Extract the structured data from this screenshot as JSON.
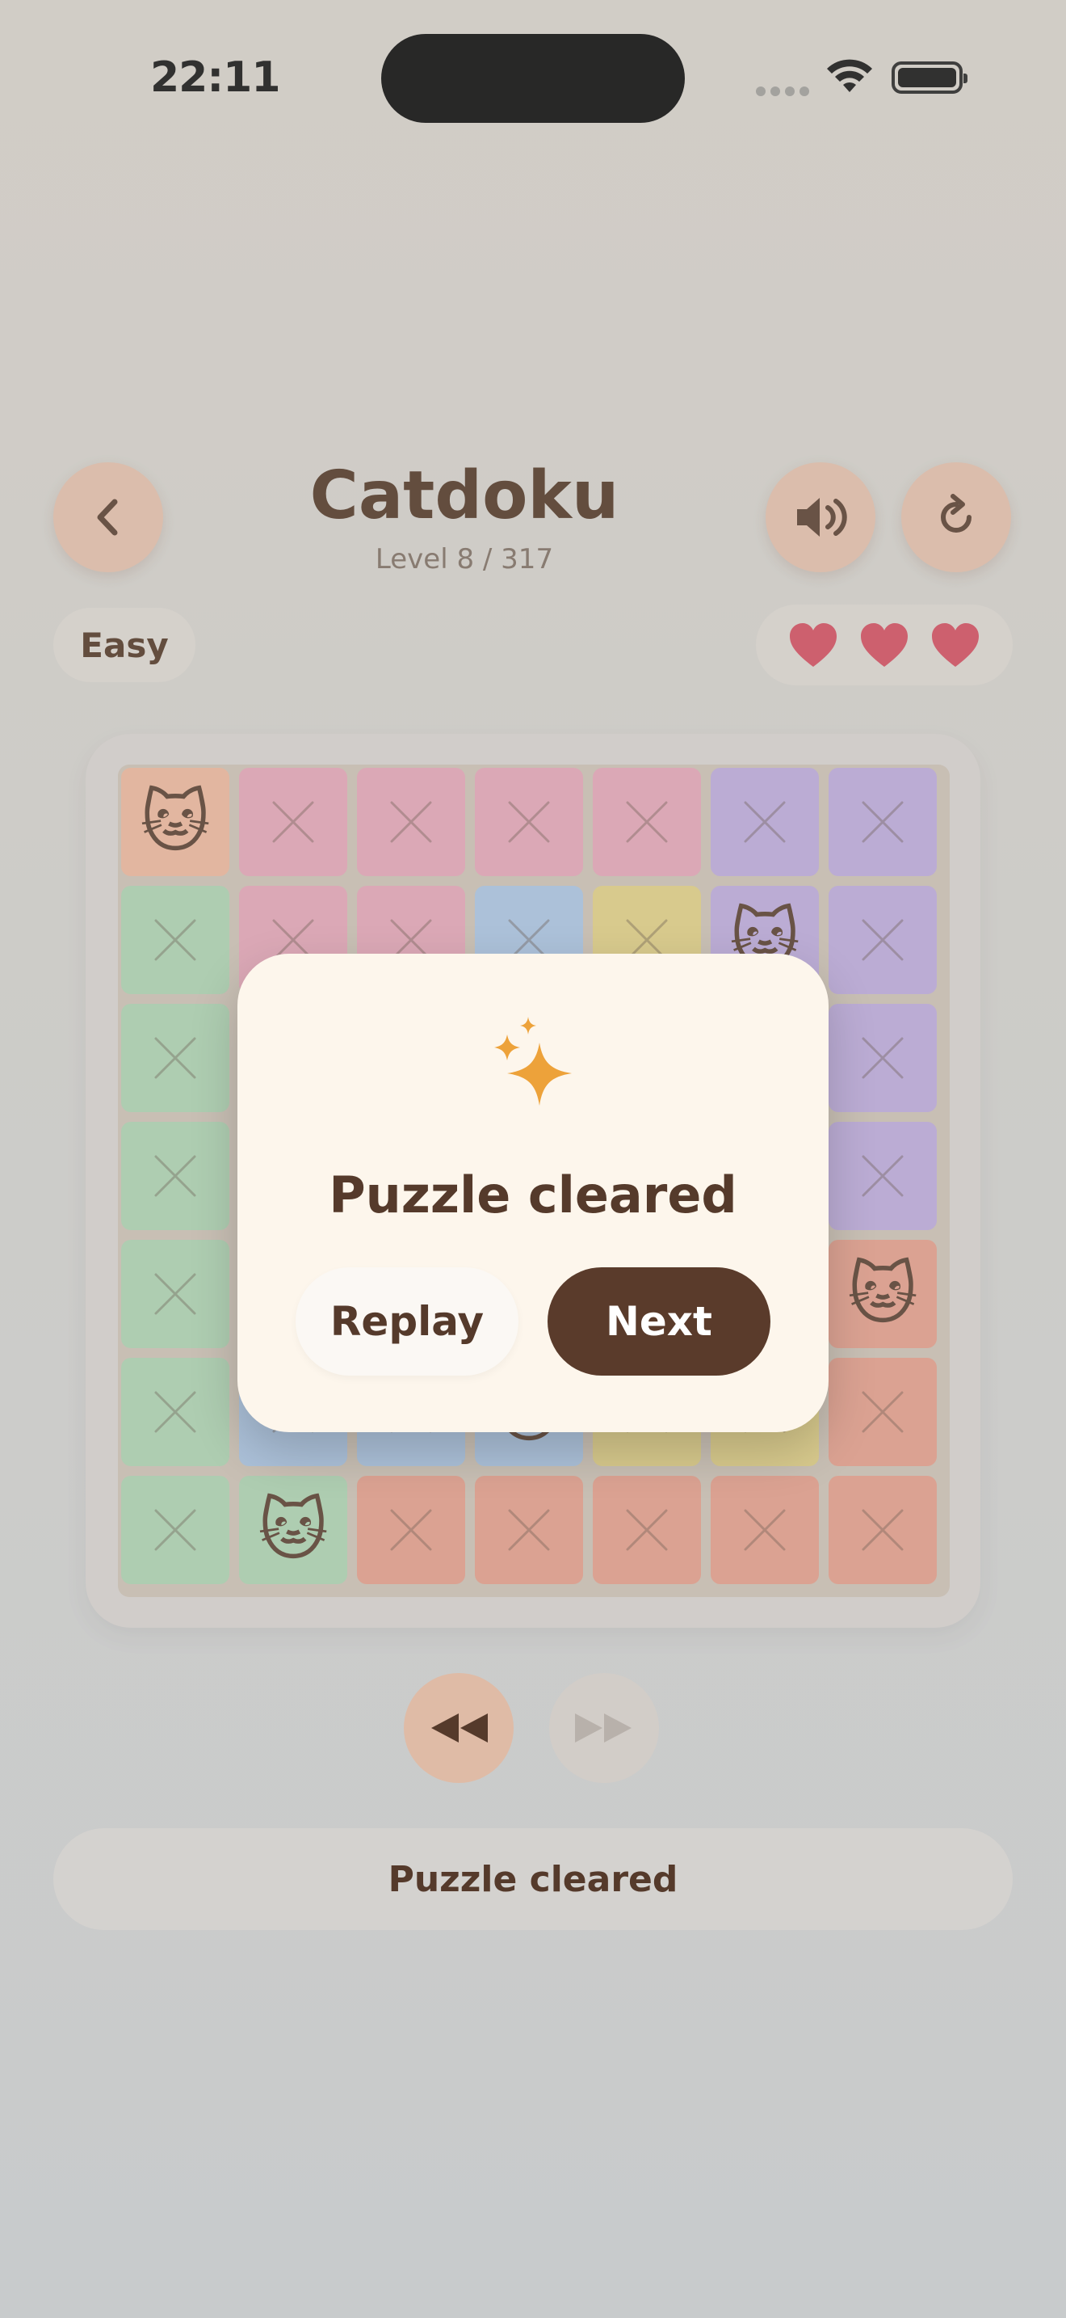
{
  "status_bar": {
    "time": "22:11"
  },
  "header": {
    "title": "Catdoku",
    "level_text": "Level 8 / 317",
    "difficulty": "Easy",
    "lives": 3
  },
  "colors": {
    "orange": "#e8b399",
    "pink": "#e0a2b4",
    "purple": "#b9a6d8",
    "green": "#a9cfae",
    "blue": "#a6c0de",
    "yellow": "#dccb82",
    "salmon": "#e09a88",
    "heart": "#cf4a5c",
    "accent_brown": "#5a3b2b",
    "sparkle": "#eda23a"
  },
  "board": {
    "size": 7,
    "regions": [
      [
        "orange",
        "pink",
        "pink",
        "pink",
        "pink",
        "purple",
        "purple"
      ],
      [
        "green",
        "pink",
        "pink",
        "blue",
        "yellow",
        "purple",
        "purple"
      ],
      [
        "green",
        "green",
        "blue",
        "blue",
        "yellow",
        "purple",
        "purple"
      ],
      [
        "green",
        "green",
        "blue",
        "blue",
        "yellow",
        "yellow",
        "purple"
      ],
      [
        "green",
        "blue",
        "blue",
        "yellow",
        "yellow",
        "yellow",
        "salmon"
      ],
      [
        "green",
        "blue",
        "blue",
        "blue",
        "yellow",
        "yellow",
        "salmon"
      ],
      [
        "green",
        "green",
        "salmon",
        "salmon",
        "salmon",
        "salmon",
        "salmon"
      ]
    ],
    "marks": [
      [
        "cat",
        "x",
        "x",
        "x",
        "x",
        "x",
        "x"
      ],
      [
        "x",
        "x",
        "x",
        "x",
        "x",
        "cat",
        "x"
      ],
      [
        "x",
        "x",
        "cat",
        "x",
        "x",
        "x",
        "x"
      ],
      [
        "x",
        "x",
        "x",
        "x",
        "cat",
        "x",
        "x"
      ],
      [
        "x",
        "x",
        "x",
        "x",
        "x",
        "x",
        "cat"
      ],
      [
        "x",
        "x",
        "x",
        "cat",
        "x",
        "x",
        "x"
      ],
      [
        "x",
        "cat",
        "x",
        "x",
        "x",
        "x",
        "x"
      ]
    ]
  },
  "modal": {
    "icon": "sparkles-icon",
    "title": "Puzzle cleared",
    "replay_label": "Replay",
    "next_label": "Next"
  },
  "footer": {
    "status_message": "Puzzle cleared"
  }
}
